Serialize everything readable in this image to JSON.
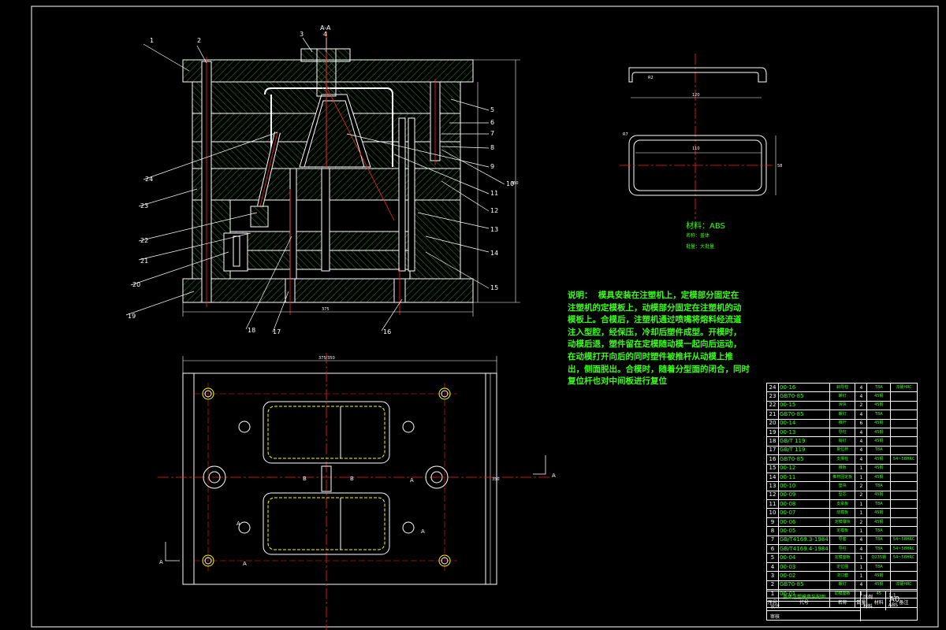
{
  "drawing": {
    "leader_numbers": [
      "1",
      "2",
      "3",
      "4",
      "5",
      "6",
      "7",
      "8",
      "9",
      "10",
      "11",
      "12",
      "13",
      "14",
      "15",
      "16",
      "17",
      "18",
      "19",
      "20",
      "21",
      "22",
      "23",
      "24"
    ],
    "section_mark": "A-A",
    "section_letters": [
      "A",
      "A",
      "B",
      "B",
      "A",
      "A",
      "A",
      "A"
    ],
    "dimension_labels": {
      "width_top": "375",
      "height_right": "350",
      "plan_width": "375/350",
      "plan_height": "350",
      "part_r": "R2",
      "part_w1": "120",
      "part_w2": "110",
      "part_h": "58",
      "part_r2": "R7"
    }
  },
  "material": {
    "label": "材料：ABS",
    "line2": "名称：盖体",
    "line3": "批量：大批量"
  },
  "notes": {
    "heading": "说明：",
    "lines": [
      "模具安装在注塑机上，定模部分固定在",
      "注塑机的定模板上，动模部分固定在注塑机的动",
      "模板上。合模后，注塑机通过喷嘴将熔料经流道",
      "注入型腔，经保压，冷却后塑件成型。开模时，",
      "动模后退，塑件留在定模随动模一起向后运动，",
      "在动模打开向后的同时塑件被推杆从动模上推",
      "出，侧面脱出。合模时，随着分型面的闭合，同时",
      "复位杆也对中间板进行复位"
    ]
  },
  "parts": [
    {
      "no": "24",
      "code": "00-16",
      "name": "斜导柱",
      "qty": "4",
      "mat": "T8A",
      "rem": "淬硬HRC"
    },
    {
      "no": "23",
      "code": "GB70-85",
      "name": "螺钉",
      "qty": "4",
      "mat": "45钢",
      "rem": ""
    },
    {
      "no": "22",
      "code": "00-15",
      "name": "滑块",
      "qty": "2",
      "mat": "45钢",
      "rem": ""
    },
    {
      "no": "21",
      "code": "GB70-85",
      "name": "螺钉",
      "qty": "4",
      "mat": "T8A",
      "rem": ""
    },
    {
      "no": "20",
      "code": "00-14",
      "name": "推杆",
      "qty": "6",
      "mat": "45钢",
      "rem": ""
    },
    {
      "no": "19",
      "code": "00-13",
      "name": "导柱",
      "qty": "4",
      "mat": "45钢",
      "rem": ""
    },
    {
      "no": "18",
      "code": "GB/T 119",
      "name": "销钉",
      "qty": "4",
      "mat": "45钢",
      "rem": ""
    },
    {
      "no": "17",
      "code": "GB/T 119",
      "name": "复位杆",
      "qty": "4",
      "mat": "T8A",
      "rem": ""
    },
    {
      "no": "16",
      "code": "GB70-85",
      "name": "支撑柱",
      "qty": "4",
      "mat": "45钢",
      "rem": "54~58HRC"
    },
    {
      "no": "15",
      "code": "00-12",
      "name": "推板",
      "qty": "1",
      "mat": "45钢",
      "rem": ""
    },
    {
      "no": "14",
      "code": "00-11",
      "name": "推杆固定板",
      "qty": "1",
      "mat": "45钢",
      "rem": ""
    },
    {
      "no": "13",
      "code": "00-10",
      "name": "垫块",
      "qty": "2",
      "mat": "T8A",
      "rem": ""
    },
    {
      "no": "12",
      "code": "00-09",
      "name": "型芯",
      "qty": "2",
      "mat": "45钢",
      "rem": ""
    },
    {
      "no": "11",
      "code": "00-08",
      "name": "支承板",
      "qty": "1",
      "mat": "T8A",
      "rem": ""
    },
    {
      "no": "10",
      "code": "00-07",
      "name": "动模板",
      "qty": "1",
      "mat": "45钢",
      "rem": ""
    },
    {
      "no": "9",
      "code": "00-06",
      "name": "定模镶块",
      "qty": "2",
      "mat": "45钢",
      "rem": ""
    },
    {
      "no": "8",
      "code": "00-05",
      "name": "定模板",
      "qty": "1",
      "mat": "T8A",
      "rem": ""
    },
    {
      "no": "7",
      "code": "GB/T4169.3-1984",
      "name": "导套",
      "qty": "4",
      "mat": "T8A",
      "rem": "54~58HRC"
    },
    {
      "no": "6",
      "code": "GB/T4169.4-1984",
      "name": "导柱",
      "qty": "4",
      "mat": "T8A",
      "rem": "54~58HRC"
    },
    {
      "no": "5",
      "code": "00-04",
      "name": "定模座板",
      "qty": "1",
      "mat": "Q235钢",
      "rem": "54~58HRC"
    },
    {
      "no": "4",
      "code": "00-03",
      "name": "定位圈",
      "qty": "1",
      "mat": "T8A",
      "rem": ""
    },
    {
      "no": "3",
      "code": "00-02",
      "name": "浇口套",
      "qty": "1",
      "mat": "45钢",
      "rem": ""
    },
    {
      "no": "2",
      "code": "GB70-85",
      "name": "螺钉",
      "qty": "4",
      "mat": "45钢",
      "rem": "淬硬HRC"
    },
    {
      "no": "1",
      "code": "00-01",
      "name": "动模座板",
      "qty": "1",
      "mat": "45",
      "rem": ""
    }
  ],
  "table_header": {
    "no": "序号",
    "code": "代号",
    "name": "名称",
    "qty": "数量",
    "mat": "材料",
    "rem": "备注"
  },
  "title_block": {
    "drawing_name": "盖体注塑模具装配图",
    "cell1": "比例",
    "cell2": "1:1",
    "cell3": "材料",
    "cell4": "ABS",
    "size": "A0",
    "design": "设计",
    "check": "审核"
  },
  "colors": {
    "background": "#000000",
    "line": "#ffffff",
    "green": "#39ff14",
    "red": "#ff2020",
    "yellow": "#ffff00",
    "hatch": "#2e7d32"
  }
}
